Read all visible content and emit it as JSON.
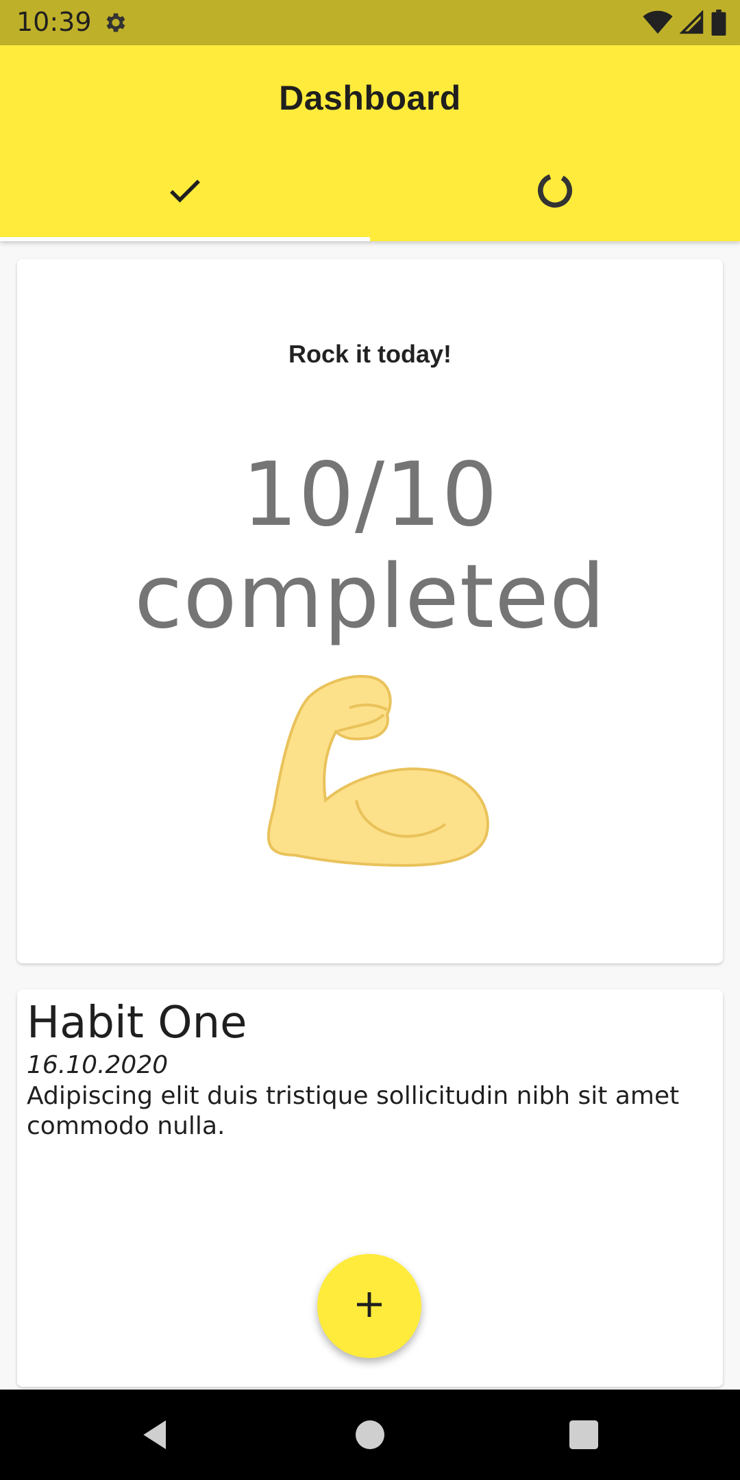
{
  "status_bar": {
    "time": "10:39",
    "icons": [
      "settings-icon",
      "wifi-icon",
      "signal-icon",
      "battery-icon"
    ]
  },
  "app_bar": {
    "title": "Dashboard",
    "tabs": [
      {
        "icon": "check-icon",
        "selected": true
      },
      {
        "icon": "progress-ring-icon",
        "selected": false
      }
    ]
  },
  "summary_card": {
    "title": "Rock it today!",
    "count_text": "10/10 completed",
    "illustration": "flexed-biceps"
  },
  "habits": [
    {
      "title": "Habit One",
      "date": "16.10.2020",
      "description": "Adipiscing elit duis tristique sollicitudin nibh sit amet commodo nulla."
    }
  ],
  "fab": {
    "icon": "plus-icon"
  },
  "nav_bar": {
    "buttons": [
      "back",
      "home",
      "recents"
    ]
  },
  "colors": {
    "primary": "#ffeb3b",
    "status_bar": "#bfb02a",
    "text_dark": "#1f1f1f",
    "count_gray": "#757575"
  }
}
